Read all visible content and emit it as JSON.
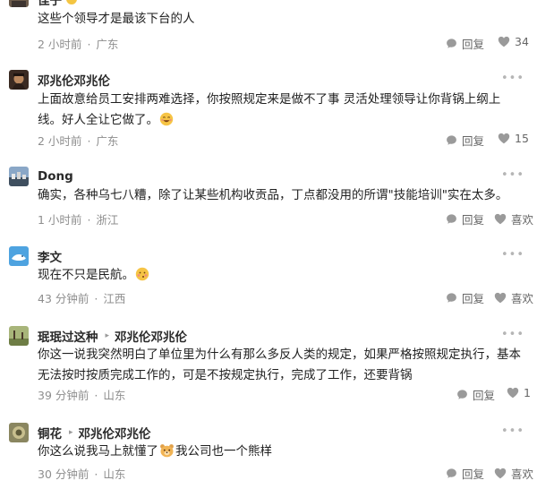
{
  "comments": [
    {
      "user": "佳子",
      "reply_to": "",
      "text": "这些个领导才是最该下台的人",
      "time": "2 小时前",
      "location": "广东",
      "reply_label": "回复",
      "like_label": "34"
    },
    {
      "user": "邓兆伦邓兆伦",
      "reply_to": "",
      "text": "上面故意给员工安排两难选择，你按照规定来是做不了事 灵活处理领导让你背锅上纲上线。好人全让它做了。",
      "time": "2 小时前",
      "location": "广东",
      "reply_label": "回复",
      "like_label": "15"
    },
    {
      "user": "Dong",
      "reply_to": "",
      "text": "确实，各种乌七八糟，除了让某些机构收贡品，丁点都没用的所谓\"技能培训\"实在太多。",
      "time": "1 小时前",
      "location": "浙江",
      "reply_label": "回复",
      "like_label": "喜欢"
    },
    {
      "user": "李文",
      "reply_to": "",
      "text": "现在不只是民航。",
      "time": "43 分钟前",
      "location": "江西",
      "reply_label": "回复",
      "like_label": "喜欢"
    },
    {
      "user": "珉珉过这种",
      "reply_to": "邓兆伦邓兆伦",
      "text": "你这一说我突然明白了单位里为什么有那么多反人类的规定，如果严格按照规定执行，基本无法按时按质完成工作的，可是不按规定执行，完成了工作，还要背锅",
      "time": "39 分钟前",
      "location": "山东",
      "reply_label": "回复",
      "like_label": "1"
    },
    {
      "user": "铜花",
      "reply_to": "邓兆伦邓兆伦",
      "text_before": "你这么说我马上就懂了",
      "text_after": "我公司也一个熊样",
      "time": "30 分钟前",
      "location": "山东",
      "reply_label": "回复",
      "like_label": "喜欢"
    }
  ],
  "icons": {
    "reply": "reply-bubble-icon",
    "like": "heart-icon",
    "more": "more-dots-icon"
  },
  "more_glyph": "•••",
  "reply_arrow_glyph": "▸",
  "meta_separator": "·"
}
